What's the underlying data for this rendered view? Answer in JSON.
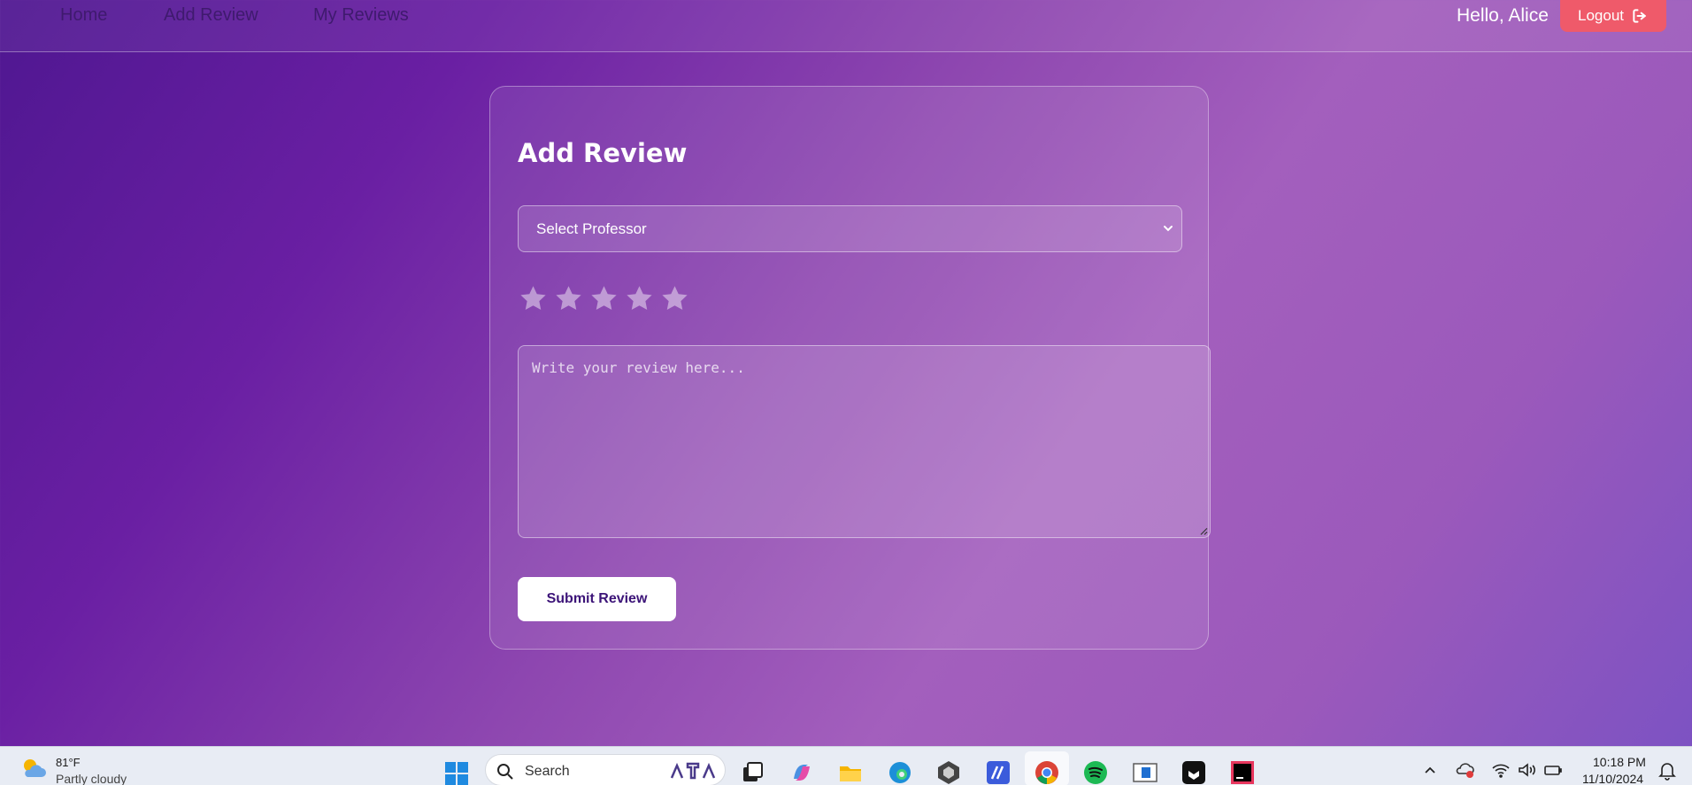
{
  "nav": {
    "links": [
      "Home",
      "Add Review",
      "My Reviews"
    ],
    "greeting": "Hello, Alice",
    "logout_label": "Logout"
  },
  "form": {
    "title": "Add Review",
    "professor_select": {
      "selected": "Select Professor"
    },
    "rating": {
      "max": 5,
      "value": 0
    },
    "review": {
      "placeholder": "Write your review here..."
    },
    "submit_label": "Submit Review"
  },
  "taskbar": {
    "weather": {
      "temp": "81°F",
      "desc": "Partly cloudy"
    },
    "search_label": "Search",
    "clock": {
      "time": "10:18 PM",
      "date": "11/10/2024"
    },
    "apps": [
      "windows-icon",
      "task-view-icon",
      "copilot-icon",
      "file-explorer-icon",
      "edge-icon",
      "app-icon",
      "app-icon",
      "chrome-icon",
      "spotify-icon",
      "app-icon",
      "app-icon",
      "intellij-icon"
    ]
  },
  "colors": {
    "logout_bg": "#ef5a6a",
    "submit_text": "#3c1478",
    "nav_link": "#3f1a6e"
  }
}
